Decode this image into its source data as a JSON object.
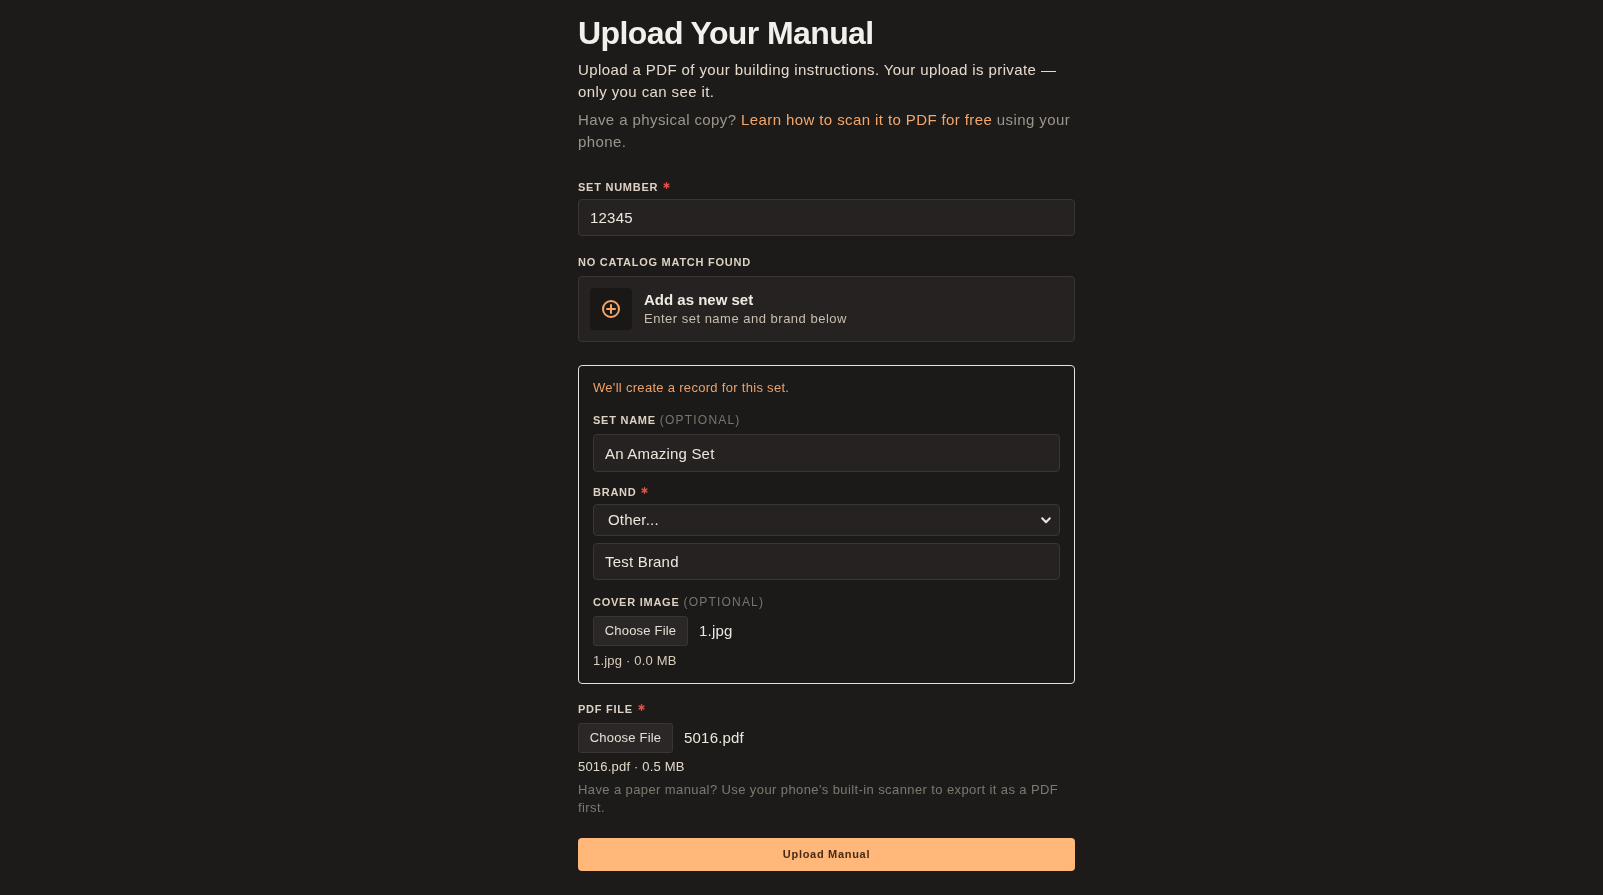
{
  "title": "Upload Your Manual",
  "intro": "Upload a PDF of your building instructions. Your upload is private — only you can see it.",
  "scan_tip": {
    "before": "Have a physical copy?",
    "link": "Learn how to scan it to PDF for free",
    "after": "using your phone."
  },
  "set_number": {
    "label": "SET NUMBER",
    "required": true,
    "value": "12345"
  },
  "catalog": {
    "heading": "NO CATALOG MATCH FOUND",
    "option": {
      "title": "Add as new set",
      "subtitle": "Enter set name and brand below"
    }
  },
  "new_set": {
    "notice": "We'll create a record for this set.",
    "set_name": {
      "label": "SET NAME",
      "hint": "(OPTIONAL)",
      "value": "An Amazing Set"
    },
    "brand": {
      "label": "BRAND",
      "required": true,
      "selected_option": "Other...",
      "custom_value": "Test Brand"
    },
    "cover_image": {
      "label": "COVER IMAGE",
      "hint": "(OPTIONAL)",
      "button": "Choose File",
      "file_name": "1.jpg",
      "file_info": "1.jpg · 0.0 MB"
    }
  },
  "pdf_file": {
    "label": "PDF FILE",
    "required": true,
    "button": "Choose File",
    "file_name": "5016.pdf",
    "file_info": "5016.pdf · 0.5 MB",
    "help": "Have a paper manual? Use your phone's built-in scanner to export it as a PDF first."
  },
  "submit": {
    "label": "Upload Manual"
  }
}
